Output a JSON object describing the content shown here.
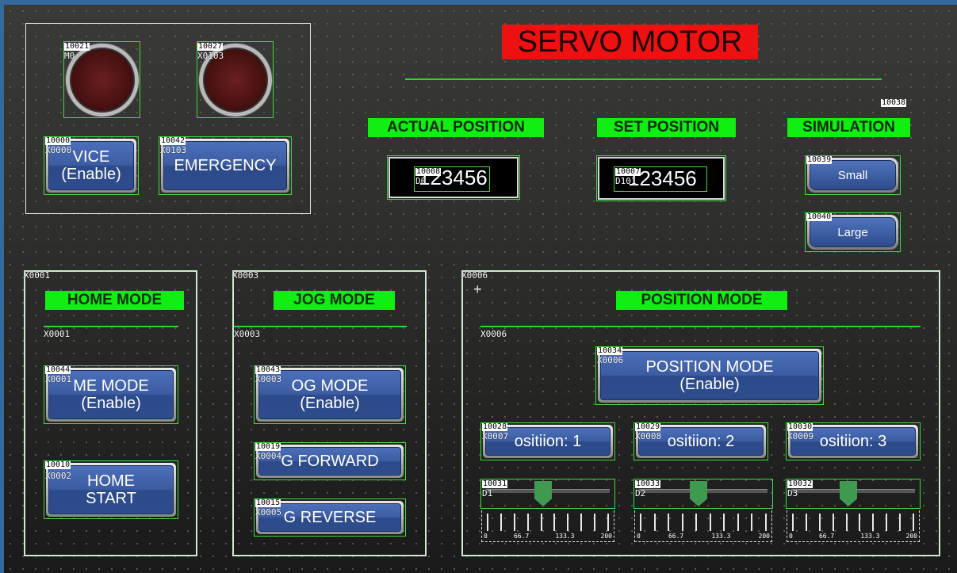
{
  "title": "SERVO MOTOR",
  "header_tag": "10038",
  "labels": {
    "actual_position": "ACTUAL POSITION",
    "set_position": "SET POSITION",
    "simulation": "SIMULATION",
    "home_mode": "HOME MODE",
    "jog_mode": "JOG MODE",
    "position_mode": "POSITION MODE"
  },
  "lamps": [
    {
      "tag": "10021",
      "addr": "M0"
    },
    {
      "tag": "10027",
      "addr": "X0103"
    }
  ],
  "top_buttons": [
    {
      "tag": "10000",
      "addr": "X0000",
      "label": "VICE\n(Enable)"
    },
    {
      "tag": "10042",
      "addr": "X0103",
      "label": "EMERGENCY"
    }
  ],
  "actual_display": {
    "tag": "10008",
    "addr": "D0",
    "value": "123456"
  },
  "set_display": {
    "tag": "10007",
    "addr": "D101",
    "value": "123456"
  },
  "simulation_buttons": [
    {
      "tag": "10039",
      "label": "Small"
    },
    {
      "tag": "10040",
      "label": "Large"
    }
  ],
  "home_panel": {
    "frame_tag": "X0001",
    "line_tag": "X0001",
    "btn1": {
      "tag": "10044",
      "addr": "X0001",
      "label": "ME MODE\n(Enable)"
    },
    "btn2": {
      "tag": "10010",
      "addr": "X0002",
      "label": "HOME\nSTART"
    }
  },
  "jog_panel": {
    "frame_tag": "X0003",
    "line_tag": "X0003",
    "btn1": {
      "tag": "10043",
      "addr": "X0003",
      "label": "OG MODE\n(Enable)"
    },
    "btn2": {
      "tag": "10019",
      "addr": "X0004",
      "label": "G FORWARD"
    },
    "btn3": {
      "tag": "10015",
      "addr": "X0005",
      "label": "G REVERSE"
    }
  },
  "position_panel": {
    "frame_tag": "X0006",
    "line_tag": "X0006",
    "main_btn": {
      "tag": "10034",
      "addr": "X0006",
      "label": "POSITION MODE\n(Enable)"
    },
    "pos_buttons": [
      {
        "tag": "10028",
        "addr": "X0007",
        "label": "ositiion: 1"
      },
      {
        "tag": "10029",
        "addr": "X0008",
        "label": "ositiion: 2"
      },
      {
        "tag": "10030",
        "addr": "X0009",
        "label": "ositiion: 3"
      }
    ],
    "sliders": [
      {
        "tag": "10031",
        "addr": "D1",
        "value": 0.46
      },
      {
        "tag": "10033",
        "addr": "D2",
        "value": 0.46
      },
      {
        "tag": "10032",
        "addr": "D3",
        "value": 0.46
      }
    ],
    "scale_labels": [
      "0",
      "66.7",
      "133.3",
      "200"
    ]
  }
}
